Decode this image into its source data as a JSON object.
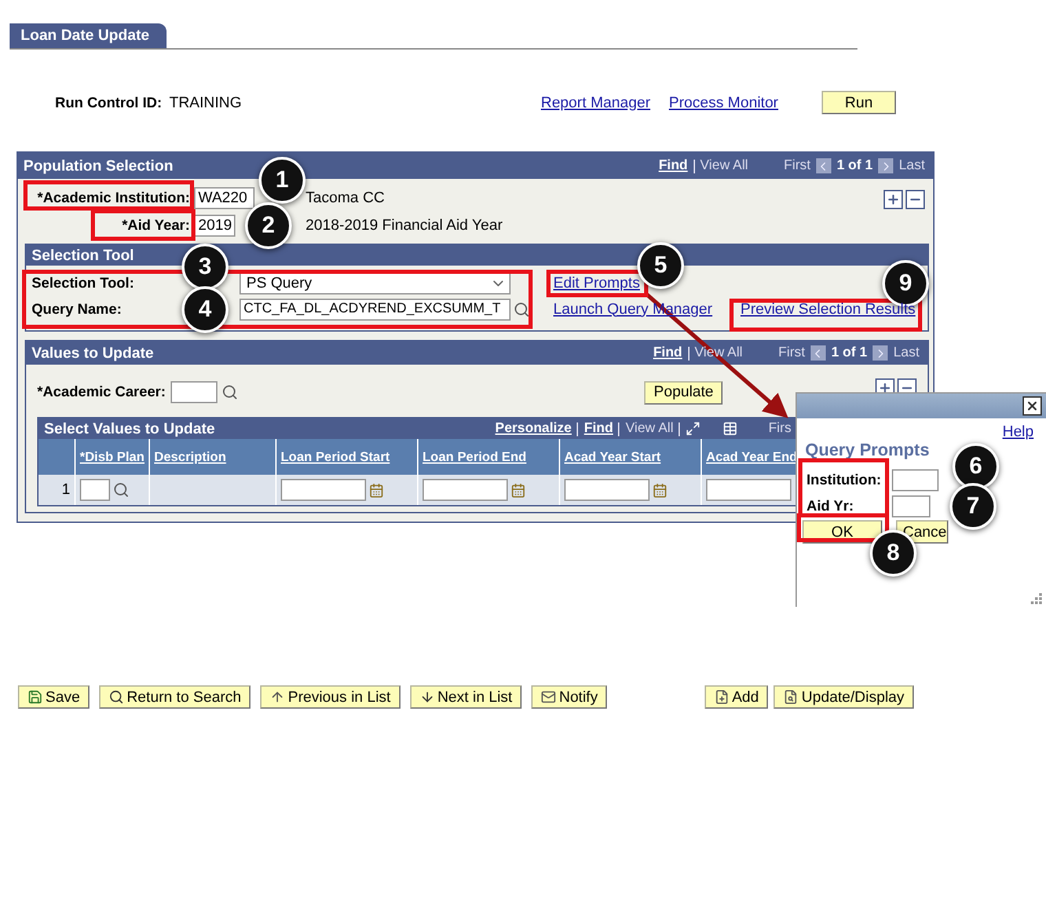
{
  "tab": {
    "label": "Loan Date Update",
    "selected": true
  },
  "run_control": {
    "label": "Run Control ID:",
    "value": "TRAINING"
  },
  "header_links": [
    "Report Manager",
    "Process Monitor"
  ],
  "run_button": "Run",
  "population_selection": {
    "title": "Population Selection",
    "nav": {
      "find": "Find",
      "view_all": "View All",
      "first": "First",
      "count": "1 of 1",
      "last": "Last"
    },
    "fields": [
      {
        "label": "*Academic Institution:",
        "value": "WA220",
        "description": "Tacoma CC"
      },
      {
        "label": "*Aid Year:",
        "value": "2019",
        "description": "2018-2019 Financial Aid Year"
      }
    ],
    "selection_tool": {
      "title": "Selection Tool",
      "tool_label": "Selection Tool:",
      "tool_value": "PS Query",
      "query_label": "Query Name:",
      "query_value": "CTC_FA_DL_ACDYREND_EXCSUMM_T",
      "links": [
        "Edit Prompts",
        "Launch Query Manager",
        "Preview Selection Results"
      ]
    },
    "values_to_update": {
      "title": "Values to Update",
      "nav": {
        "find": "Find",
        "view_all": "View All",
        "first": "First",
        "count": "1 of 1",
        "last": "Last"
      },
      "career_label": "*Academic Career:",
      "populate_button": "Populate",
      "grid": {
        "title": "Select Values to Update",
        "toolbar": [
          "Personalize",
          "Find",
          "View All"
        ],
        "first": "Firs",
        "columns": [
          "*Disb Plan",
          "Description",
          "Loan Period Start",
          "Loan Period End",
          "Acad Year Start",
          "Acad Year End"
        ],
        "rows": [
          {
            "number": "1"
          }
        ]
      }
    }
  },
  "buttons_left": [
    "Save",
    "Return to Search",
    "Previous in List",
    "Next in List",
    "Notify"
  ],
  "buttons_right": [
    "Add",
    "Update/Display"
  ],
  "dialog": {
    "help": "Help",
    "title": "Query Prompts",
    "fields": [
      "Institution:",
      "Aid Yr:"
    ],
    "ok": "OK",
    "cancel": "Cance"
  },
  "callouts": [
    "1",
    "2",
    "3",
    "4",
    "5",
    "6",
    "7",
    "8",
    "9"
  ]
}
